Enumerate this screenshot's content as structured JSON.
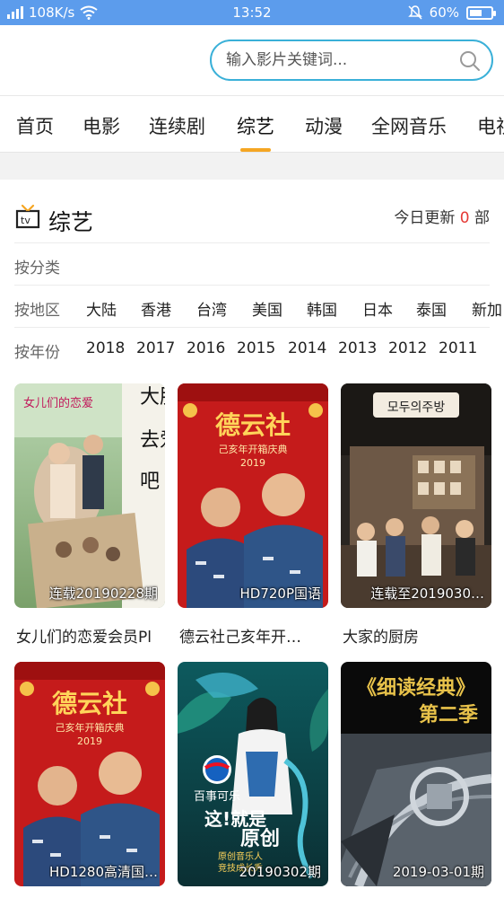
{
  "status_bar": {
    "network_speed": "108K/s",
    "time": "13:52",
    "battery_pct": "60%",
    "battery_level": 0.6
  },
  "search": {
    "placeholder": "输入影片关键词..."
  },
  "nav": {
    "tabs": [
      "首页",
      "电影",
      "连续剧",
      "综艺",
      "动漫",
      "全网音乐",
      "电视"
    ],
    "active_index": 3
  },
  "section": {
    "title": "综艺",
    "update_prefix": "今日更新",
    "update_count": "0",
    "update_suffix": "部"
  },
  "filters": {
    "category_label": "按分类",
    "region_label": "按地区",
    "regions": [
      "大陆",
      "香港",
      "台湾",
      "美国",
      "韩国",
      "日本",
      "泰国",
      "新加"
    ],
    "year_label": "按年份",
    "years": [
      "2018",
      "2017",
      "2016",
      "2015",
      "2014",
      "2013",
      "2012",
      "2011"
    ]
  },
  "cards": [
    {
      "title": "女儿们的恋爱会员Pl",
      "badge": "连载20190228期",
      "poster_text": [
        "大胆",
        "去爱",
        "吧"
      ],
      "logo": "女儿们的恋爱"
    },
    {
      "title": "德云社己亥年开…",
      "badge": "HD720P国语",
      "poster_text": [
        "德云社",
        "己亥年开箱庆典",
        "2019"
      ]
    },
    {
      "title": "大家的厨房",
      "badge": "连载至2019030…",
      "poster_text": [
        "모두의주방"
      ]
    },
    {
      "title": "",
      "badge": "HD1280高清国…",
      "poster_text": [
        "德云社",
        "己亥年开箱庆典",
        "2019"
      ]
    },
    {
      "title": "",
      "badge": "20190302期",
      "poster_text": [
        "百事可乐",
        "这!就是",
        "原创",
        "原创音乐人",
        "竞技成长秀"
      ]
    },
    {
      "title": "",
      "badge": "2019-03-01期",
      "poster_text": [
        "《细读经典》",
        "第二季"
      ]
    }
  ],
  "colors": {
    "status_bar": "#5c9cec",
    "search_border": "#3ab0d8",
    "tab_underline": "#f5a623",
    "update_count": "#e53935"
  }
}
